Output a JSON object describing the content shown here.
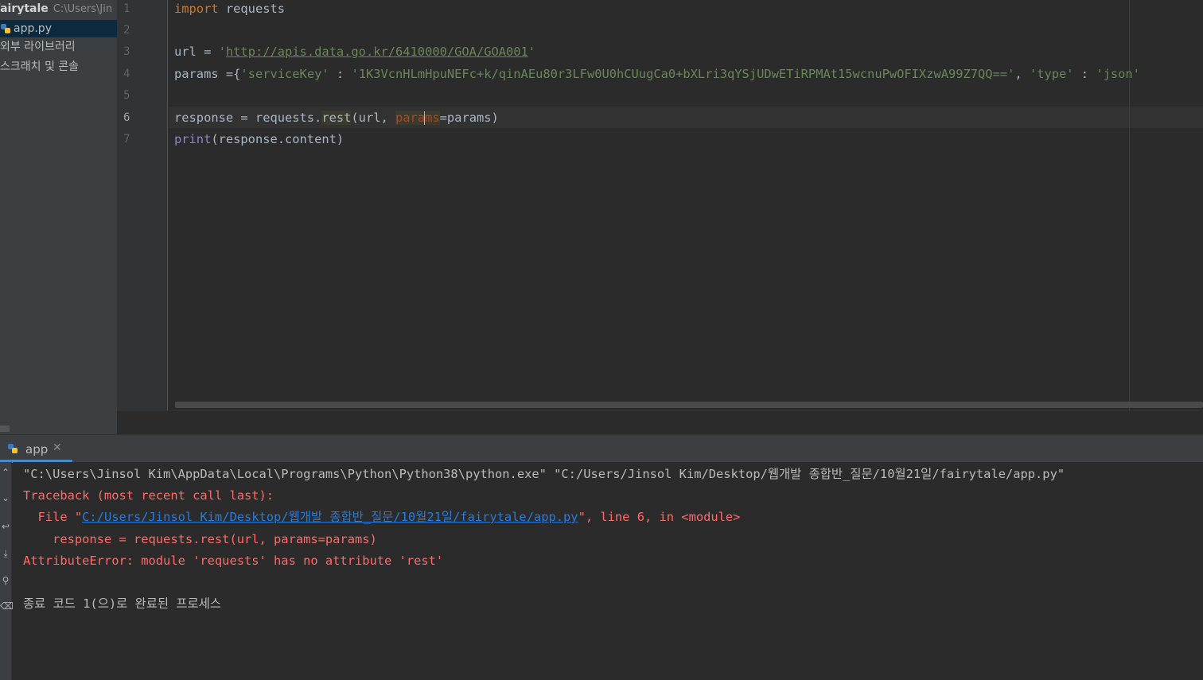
{
  "project": {
    "root_name": "fairytale",
    "root_path": "C:\\Users\\Jin",
    "items": [
      {
        "label": "app.py",
        "selected": true,
        "icon": "python-file-icon"
      },
      {
        "label": "외부 라이브러리",
        "selected": false
      },
      {
        "label": "스크래치 및 콘솔",
        "selected": false
      }
    ]
  },
  "editor": {
    "line_numbers": [
      "1",
      "2",
      "3",
      "4",
      "5",
      "6",
      "7"
    ],
    "current_line": "6",
    "lines": {
      "l1": {
        "kw": "import",
        "rest": " requests"
      },
      "l3": {
        "a": "url = ",
        "q1": "'",
        "url": "http://apis.data.go.kr/6410000/GOA/GOA001",
        "q2": "'"
      },
      "l4": {
        "a": "params =",
        "brace": "{",
        "k1": "'serviceKey'",
        "colon1": " : ",
        "v1": "'1K3VcnHLmHpuNEFc+k/qinAEu80r3LFw0U0hCUugCa0+bXLri3qYSjUDwETiRPMAt15wcnuPwOFIXzwA99Z7QQ=='",
        "comma": ", ",
        "k2": "'type'",
        "colon2": " : ",
        "v2": "'json'"
      },
      "l6": {
        "a": "response = requests.",
        "method": "rest",
        "b": "(url, ",
        "param1": "para",
        "param2": "ms",
        "c": "=params)"
      },
      "l7": {
        "fn": "print",
        "rest": "(response.content)"
      }
    }
  },
  "run": {
    "tab_label": "app",
    "tab_close": "✕",
    "console": {
      "cmd": "\"C:\\Users\\Jinsol Kim\\AppData\\Local\\Programs\\Python\\Python38\\python.exe\" \"C:/Users/Jinsol Kim/Desktop/웹개발 종합반_질문/10월21일/fairytale/app.py\"",
      "traceback": "Traceback (most recent call last):",
      "file_prefix": "  File \"",
      "file_link": "C:/Users/Jinsol Kim/Desktop/웹개발 종합반_질문/10월21일/fairytale/app.py",
      "file_suffix": "\", line 6, in <module>",
      "code": "    response = requests.rest(url, params=params)",
      "error": "AttributeError: module 'requests' has no attribute 'rest'",
      "exit": "종료 코드 1(으)로 완료된 프로세스"
    }
  },
  "colors": {
    "keyword": "#cc7832",
    "string": "#6a8759",
    "builtin": "#8888c6",
    "error": "#ff6b68",
    "link": "#287bde"
  }
}
